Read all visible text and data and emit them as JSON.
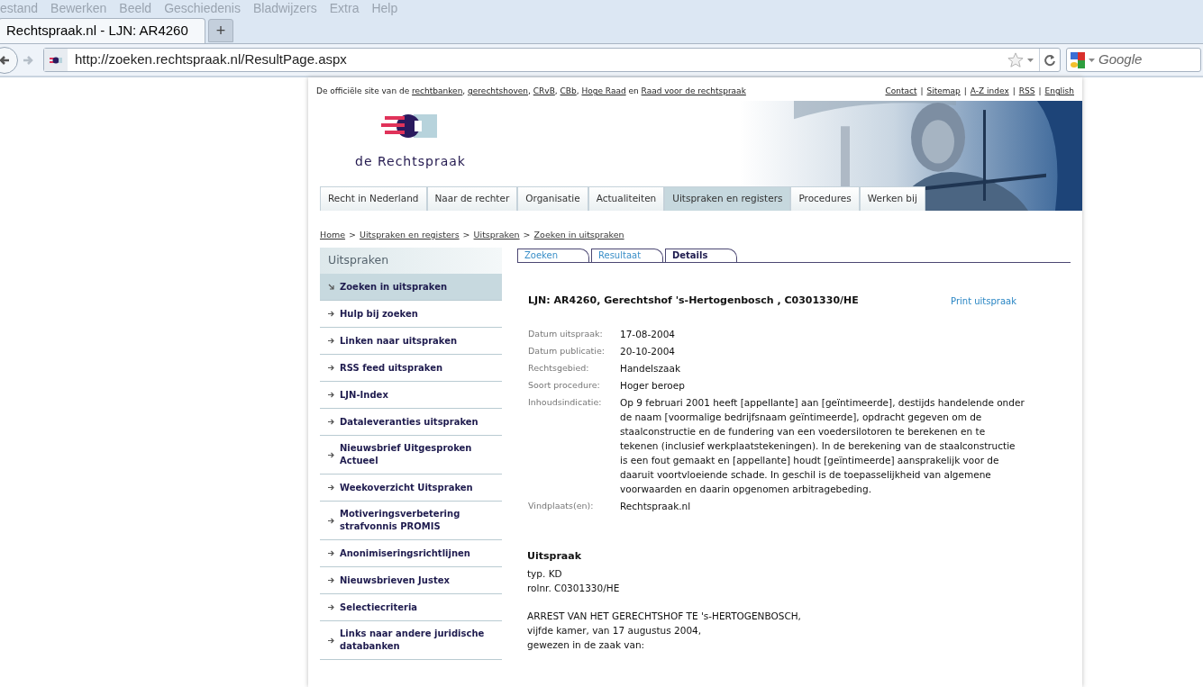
{
  "browser": {
    "menu": [
      "estand",
      "Bewerken",
      "Beeld",
      "Geschiedenis",
      "Bladwijzers",
      "Extra",
      "Help"
    ],
    "tabs": [
      {
        "label": "Rechtspraak.nl - LJN: AR4260",
        "selected": true
      }
    ],
    "new_tab": "+",
    "address": "http://zoeken.rechtspraak.nl/ResultPage.aspx",
    "search": {
      "placeholder": "Google"
    }
  },
  "top_bar": {
    "intro": [
      {
        "text": "De officiële site van de ",
        "link": false
      },
      {
        "text": "rechtbanken",
        "link": true
      },
      {
        "text": ", ",
        "link": false
      },
      {
        "text": "gerechtshoven",
        "link": true
      },
      {
        "text": ", ",
        "link": false
      },
      {
        "text": "CRvB",
        "link": true
      },
      {
        "text": ", ",
        "link": false
      },
      {
        "text": "CBb",
        "link": true
      },
      {
        "text": ", ",
        "link": false
      },
      {
        "text": "Hoge Raad",
        "link": true
      },
      {
        "text": " en ",
        "link": false
      },
      {
        "text": "Raad voor de rechtspraak",
        "link": true
      }
    ],
    "separator": "|",
    "links": [
      "Contact",
      "Sitemap",
      "A-Z index",
      "RSS",
      "English"
    ]
  },
  "logo": {
    "text": "de Rechtspraak"
  },
  "nav": [
    {
      "label": "Recht in Nederland",
      "selected": false
    },
    {
      "label": "Naar de rechter",
      "selected": false
    },
    {
      "label": "Organisatie",
      "selected": false
    },
    {
      "label": "Actualiteiten",
      "selected": false
    },
    {
      "label": "Uitspraken en registers",
      "selected": true
    },
    {
      "label": "Procedures",
      "selected": false
    },
    {
      "label": "Werken bij",
      "selected": false
    }
  ],
  "breadcrumb": {
    "separator": ">",
    "items": [
      "Home",
      "Uitspraken en registers",
      "Uitspraken",
      "Zoeken in uitspraken"
    ]
  },
  "sidebar": {
    "title": "Uitspraken",
    "items": [
      {
        "label": "Zoeken in uitspraken",
        "selected": true
      },
      {
        "label": "Hulp bij zoeken",
        "selected": false
      },
      {
        "label": "Linken naar uitspraken",
        "selected": false
      },
      {
        "label": "RSS feed uitspraken",
        "selected": false
      },
      {
        "label": "LJN-Index",
        "selected": false
      },
      {
        "label": "Dataleveranties uitspraken",
        "selected": false
      },
      {
        "label": "Nieuwsbrief Uitgesproken Actueel",
        "selected": false
      },
      {
        "label": "Weekoverzicht Uitspraken",
        "selected": false
      },
      {
        "label": "Motiveringsverbetering strafvonnis PROMIS",
        "selected": false
      },
      {
        "label": "Anonimiseringsrichtlijnen",
        "selected": false
      },
      {
        "label": "Nieuwsbrieven Justex",
        "selected": false
      },
      {
        "label": "Selectiecriteria",
        "selected": false
      },
      {
        "label": "Links naar andere juridische databanken",
        "selected": false
      }
    ]
  },
  "content_tabs": [
    {
      "label": "Zoeken",
      "selected": false
    },
    {
      "label": "Resultaat",
      "selected": false
    },
    {
      "label": "Details",
      "selected": true
    }
  ],
  "heading": "LJN: AR4260, Gerechtshof 's-Hertogenbosch , C0301330/HE",
  "print_link": "Print uitspraak",
  "fields": [
    {
      "label": "Datum uitspraak:",
      "value": "17-08-2004"
    },
    {
      "label": "Datum publicatie:",
      "value": "20-10-2004"
    },
    {
      "label": "Rechtsgebied:",
      "value": "Handelszaak"
    },
    {
      "label": "Soort procedure:",
      "value": "Hoger beroep"
    },
    {
      "label": "Inhoudsindicatie:",
      "value": "Op 9 februari 2001 heeft [appellante] aan [geïntimeerde], destijds handelende onder de naam [voormalige bedrijfsnaam geïntimeerde], opdracht gegeven om de staalconstructie en de fundering van een voedersilotoren te berekenen en te tekenen (inclusief werkplaatstekeningen). In de berekening van de staalconstructie is een fout gemaakt en [appellante] houdt [geïntimeerde] aansprakelijk voor de daaruit voortvloeiende schade. In geschil is de toepasselijkheid van algemene voorwaarden en daarin opgenomen arbitragebeding."
    },
    {
      "label": "Vindplaats(en):",
      "value": "Rechtspraak.nl"
    }
  ],
  "verdict": {
    "title": "Uitspraak",
    "paragraphs": [
      [
        "typ. KD",
        "rolnr. C0301330/HE"
      ],
      [
        "ARREST VAN HET GERECHTSHOF TE 's-HERTOGENBOSCH,",
        "vijfde kamer, van 17 augustus 2004,",
        "gewezen in de zaak van:"
      ]
    ]
  }
}
